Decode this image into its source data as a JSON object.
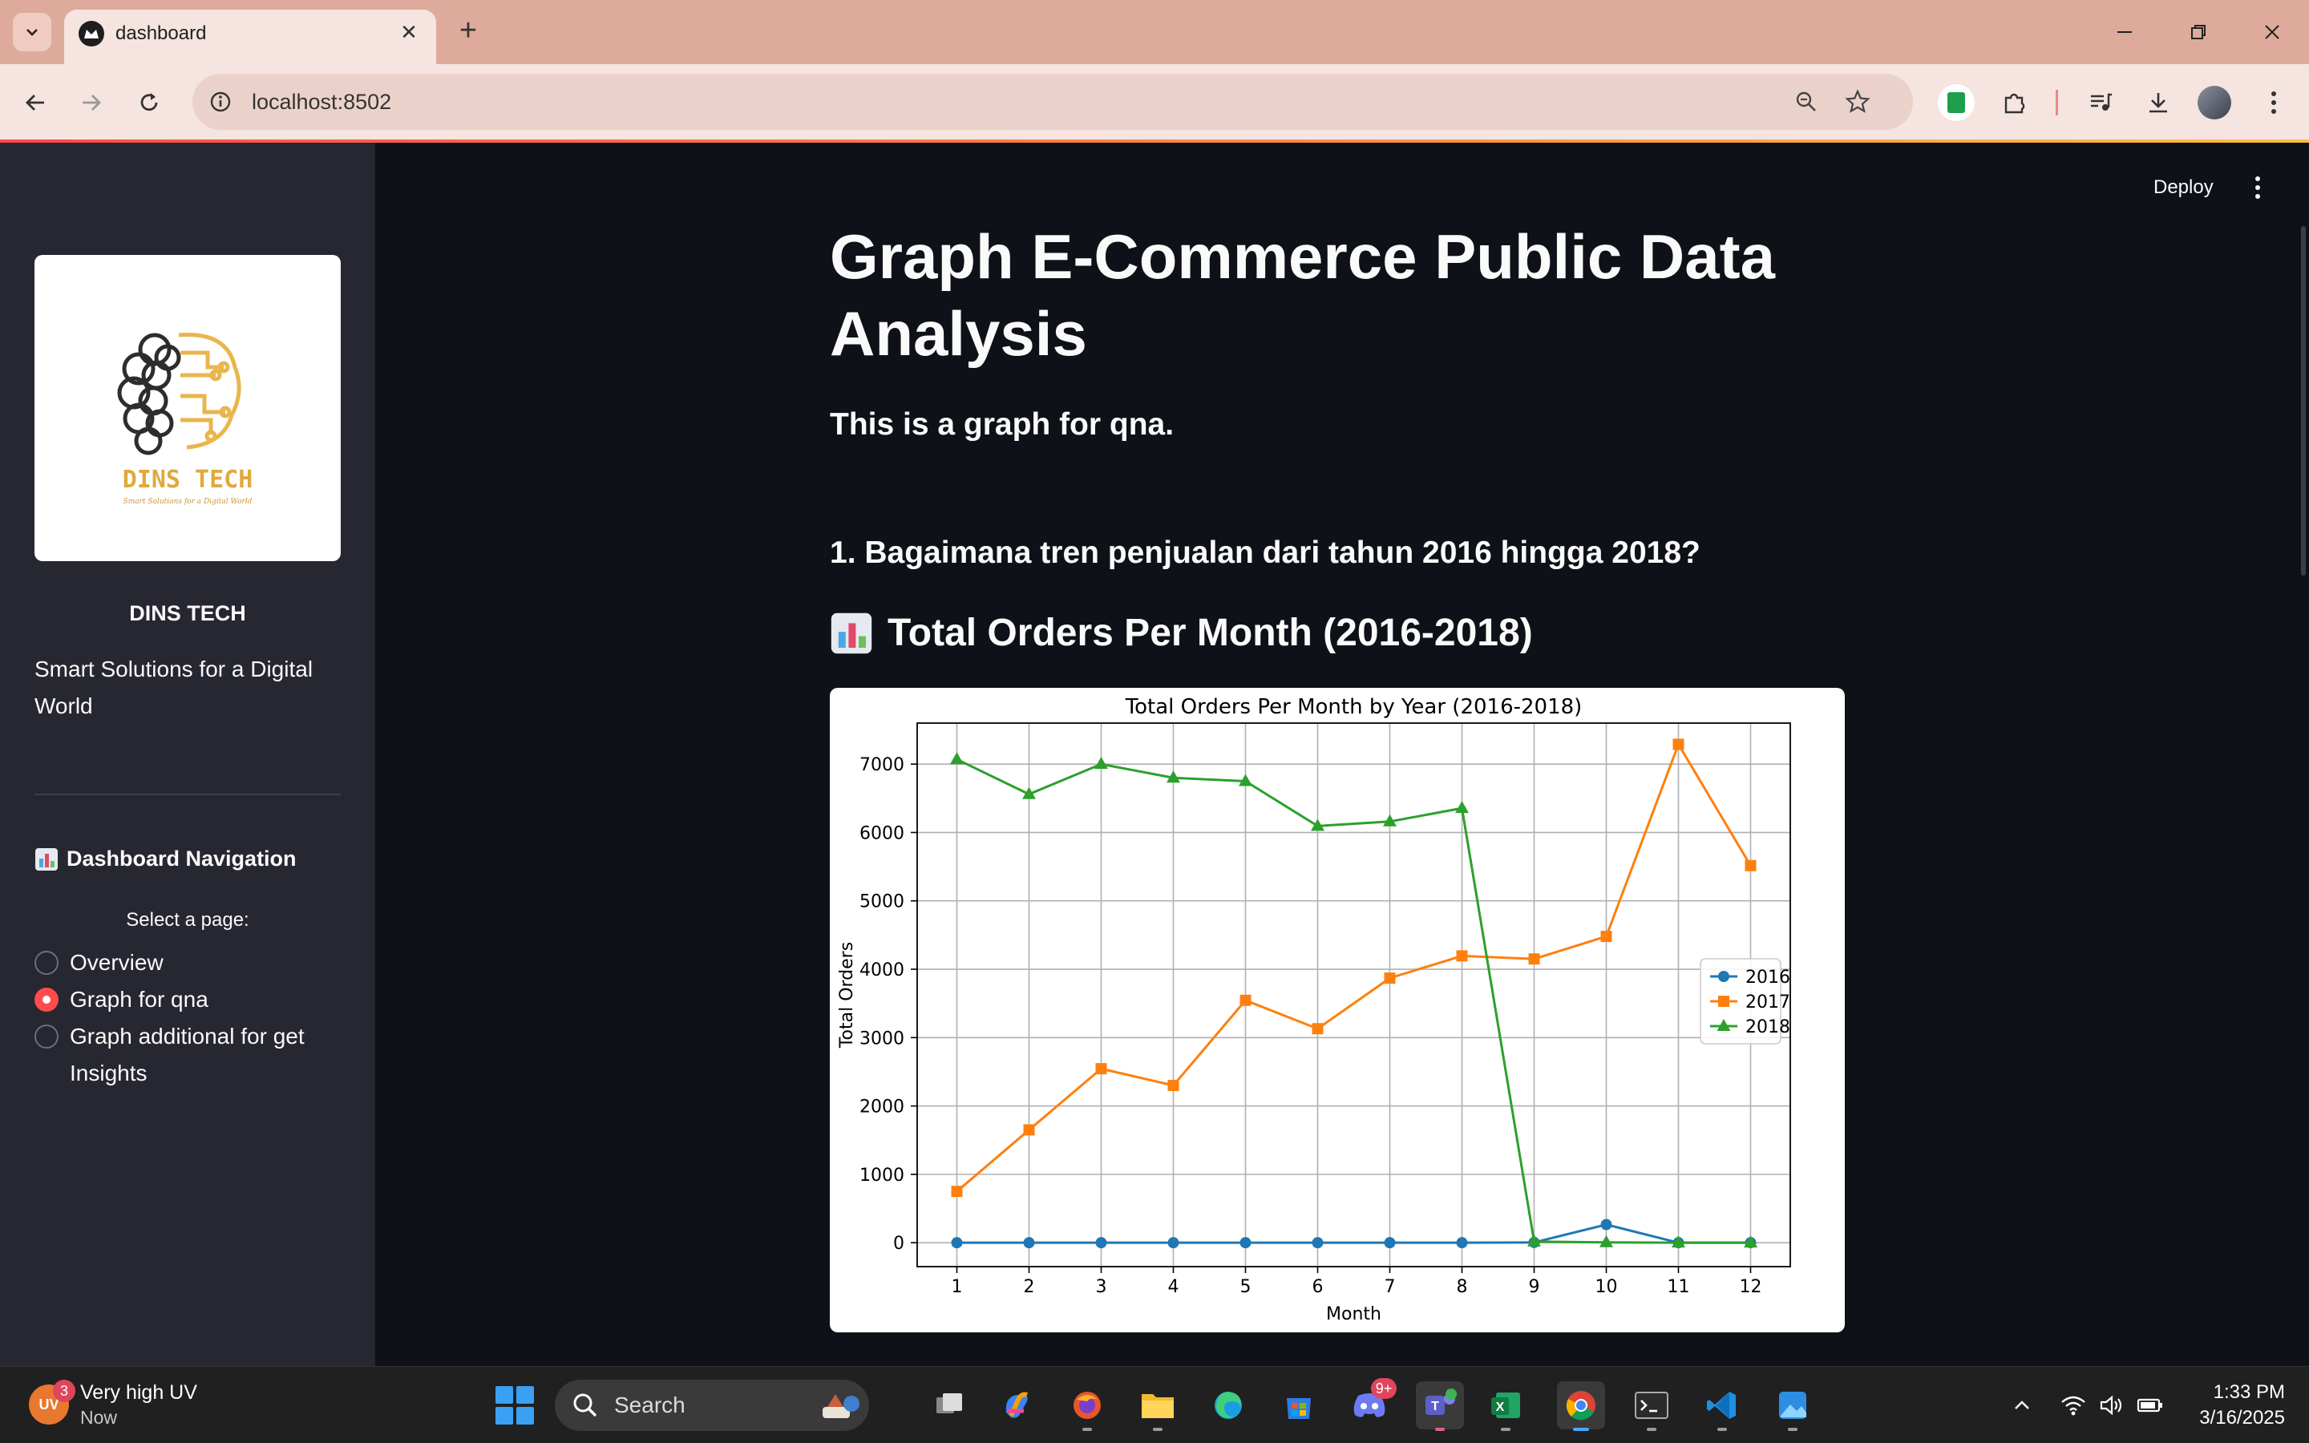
{
  "browser": {
    "tab_title": "dashboard",
    "url": "localhost:8502"
  },
  "sidebar": {
    "brand_name": "DINS TECH",
    "tagline": "Smart Solutions for a Digital World",
    "logo_text": "DINS TECH",
    "logo_subtext": "Smart Solutions for a Digital World",
    "nav_heading": "Dashboard Navigation",
    "select_label": "Select a page:",
    "options": [
      {
        "label": "Overview",
        "selected": false
      },
      {
        "label": "Graph for qna",
        "selected": true
      },
      {
        "label": "Graph additional for get Insights",
        "selected": false
      }
    ]
  },
  "header": {
    "deploy_label": "Deploy"
  },
  "main": {
    "title": "Graph E-Commerce Public Data Analysis",
    "subtitle": "This is a graph for qna.",
    "question": "1. Bagaimana tren penjualan dari tahun 2016 hingga 2018?",
    "chart_heading": "Total Orders Per Month (2016-2018)"
  },
  "chart_data": {
    "type": "line",
    "title": "Total Orders Per Month by Year (2016-2018)",
    "xlabel": "Month",
    "ylabel": "Total Orders",
    "x": [
      1,
      2,
      3,
      4,
      5,
      6,
      7,
      8,
      9,
      10,
      11,
      12
    ],
    "xlim": [
      0.45,
      12.55
    ],
    "ylim": [
      -350,
      7600
    ],
    "yticks": [
      0,
      1000,
      2000,
      3000,
      4000,
      5000,
      6000,
      7000
    ],
    "grid": true,
    "legend_position": "center-right",
    "series": [
      {
        "name": "2016",
        "color": "#1f77b4",
        "marker": "circle",
        "values": [
          0,
          0,
          0,
          0,
          0,
          0,
          0,
          0,
          4,
          265,
          0,
          1
        ]
      },
      {
        "name": "2017",
        "color": "#ff7f0e",
        "marker": "square",
        "values": [
          750,
          1650,
          2545,
          2300,
          3545,
          3130,
          3870,
          4195,
          4150,
          4480,
          7290,
          5515
        ]
      },
      {
        "name": "2018",
        "color": "#2ca02c",
        "marker": "triangle",
        "values": [
          7070,
          6560,
          7000,
          6800,
          6750,
          6095,
          6160,
          6355,
          16,
          4,
          0,
          0
        ]
      }
    ]
  },
  "taskbar": {
    "weather_title": "Very high UV",
    "weather_sub": "Now",
    "weather_badge": "3",
    "weather_icon_text": "UV",
    "search_label": "Search",
    "discord_badge": "9+",
    "time": "1:33 PM",
    "date": "3/16/2025"
  },
  "colors": {
    "accent": "#ff4b4b",
    "sidebar_bg": "#262730",
    "main_bg": "#0e1117",
    "tabstrip": "#deaa9c"
  }
}
